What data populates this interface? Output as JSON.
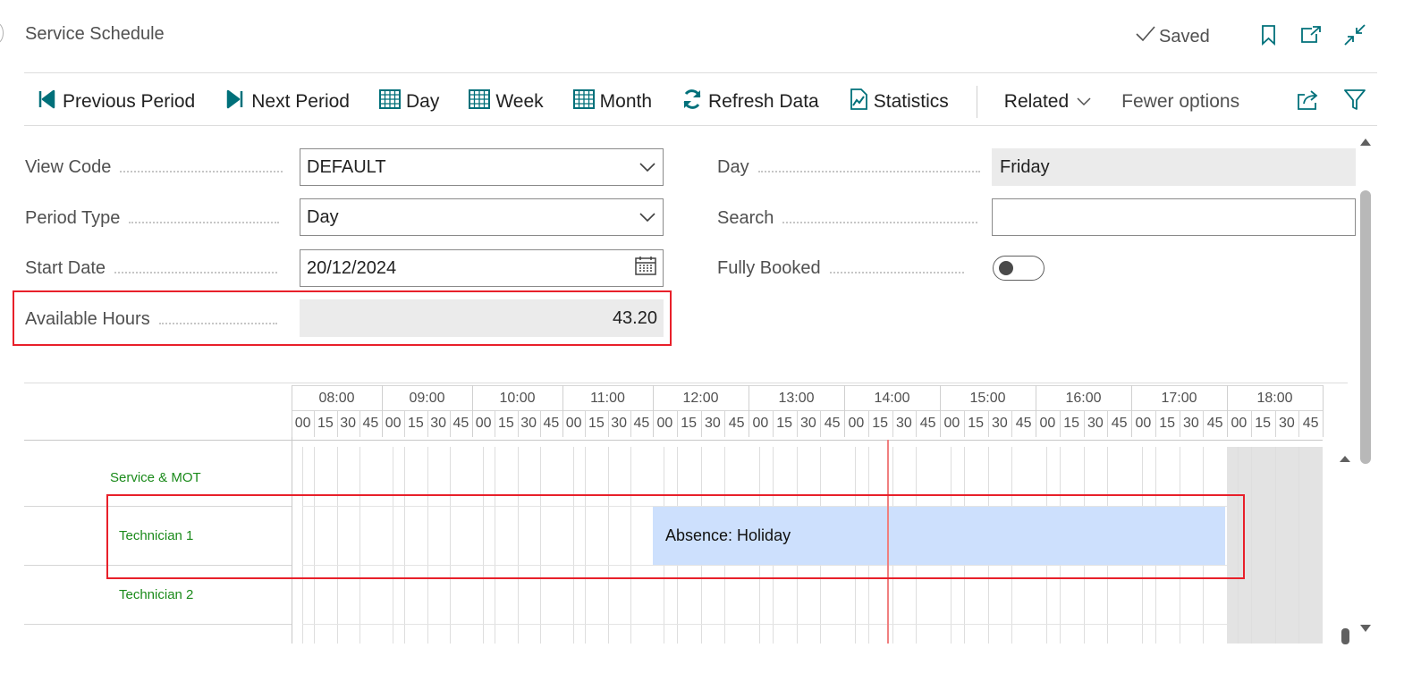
{
  "header": {
    "title": "Service Schedule",
    "saved_label": "Saved"
  },
  "toolbar": {
    "items": [
      {
        "label": "Previous Period",
        "icon": "previous-period-icon"
      },
      {
        "label": "Next Period",
        "icon": "next-period-icon"
      },
      {
        "label": "Day",
        "icon": "calendar-grid-icon"
      },
      {
        "label": "Week",
        "icon": "calendar-grid-icon"
      },
      {
        "label": "Month",
        "icon": "calendar-grid-icon"
      },
      {
        "label": "Refresh Data",
        "icon": "refresh-icon"
      },
      {
        "label": "Statistics",
        "icon": "statistics-icon"
      }
    ],
    "related_label": "Related",
    "fewer_options_label": "Fewer options"
  },
  "form": {
    "view_code": {
      "label": "View Code",
      "value": "DEFAULT"
    },
    "period_type": {
      "label": "Period Type",
      "value": "Day"
    },
    "start_date": {
      "label": "Start Date",
      "value": "20/12/2024"
    },
    "available_hours": {
      "label": "Available Hours",
      "value": "43.20"
    },
    "day": {
      "label": "Day",
      "value": "Friday"
    },
    "search": {
      "label": "Search",
      "value": ""
    },
    "fully_booked": {
      "label": "Fully Booked",
      "value": false
    }
  },
  "schedule": {
    "hours": [
      "08:00",
      "09:00",
      "10:00",
      "11:00",
      "12:00",
      "13:00",
      "14:00",
      "15:00",
      "16:00",
      "17:00",
      "18:00"
    ],
    "minutes": [
      "00",
      "15",
      "30",
      "45"
    ],
    "resources": [
      "Service & MOT",
      "Technician 1",
      "Technician 2"
    ],
    "events": [
      {
        "resource": "Technician 1",
        "label": "Absence: Holiday",
        "start": "12:00",
        "end": "18:00"
      }
    ],
    "current_time": "14:30"
  },
  "colors": {
    "accent": "#00707a",
    "highlight": "#e8202a",
    "event_fill": "#cde0fd",
    "resource_text": "#1a8a1a",
    "current_time_line": "#f08080"
  }
}
